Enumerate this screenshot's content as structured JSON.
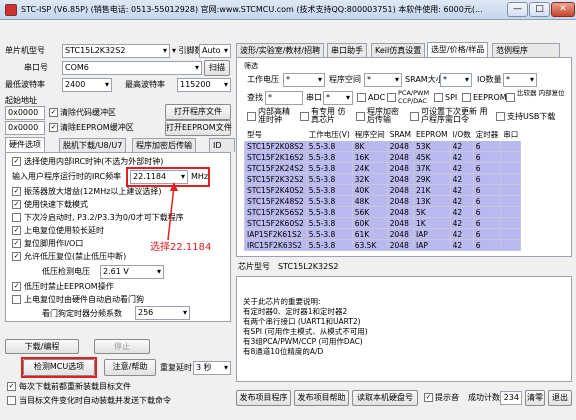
{
  "window": {
    "title": "STC-ISP (V6.85P) (销售电话: 0513-55012928) 官网:www.STCMCU.com (技术支持QQ:800003751) 本软件使用: 6000元(...",
    "min_glyph": "—",
    "max_glyph": "□",
    "close_glyph": "✕"
  },
  "left": {
    "mcu_type_label": "单片机型号",
    "mcu_type_value": "STC15L2K32S2",
    "pin_label": "▾ 引脚数",
    "pin_value": "Auto",
    "port_label": "串口号",
    "port_value": "COM6",
    "scan_button": "扫描",
    "min_baud_label": "最低波特率",
    "min_baud_value": "2400",
    "max_baud_label": "最高波特率",
    "max_baud_value": "115200",
    "start_addr_label": "起始地址",
    "addr1_value": "0x0000",
    "clear_code_label": "清除代码缓冲区",
    "open_program_button": "打开程序文件",
    "addr2_value": "0x0000",
    "clear_eeprom_label": "清除EEPROM缓冲区",
    "open_eeprom_button": "打开EEPROM文件",
    "hw_tabs": [
      "硬件选项",
      "脱机下载/U8/U7",
      "程序加密后传输",
      "ID"
    ],
    "hw_options": [
      {
        "label": "选择使用内部IRC时钟(不选为外部时钟)",
        "checked": true
      },
      {
        "label": "输入用户程序运行时的IRC频率",
        "checked": false
      },
      {
        "label": "振荡器放大增益(12MHz以上建议选择)",
        "checked": true
      },
      {
        "label": "使用快速下载模式",
        "checked": true
      },
      {
        "label": "下次冷启动时, P3.2/P3.3为0/0才可下载程序",
        "checked": false
      },
      {
        "label": "上电复位使用较长延时",
        "checked": true
      },
      {
        "label": "复位脚用作I/O口",
        "checked": true
      },
      {
        "label": "允许低压复位(禁止低压中断)",
        "checked": true
      },
      {
        "label": "低压检测电压",
        "checked": false
      },
      {
        "label": "低压时禁止EEPROM操作",
        "checked": true
      },
      {
        "label": "上电复位时由硬件自动启动看门狗",
        "checked": false
      },
      {
        "label": "看门狗定时器分频系数",
        "checked": false
      }
    ],
    "irc_freq_value": "22.1184",
    "irc_unit": "MHz",
    "voltage_value": "2.61 V",
    "watchdog_value": "256",
    "annotation": "选择22.1184",
    "download_button": "下载/编程",
    "stop_button": "停止",
    "detect_button": "检测MCU选项",
    "help_button": "注意/帮助",
    "retry_label": "重复延时",
    "retry_value": "3 秒",
    "reload_label": "每次下载前都重新装载目标文件",
    "auto_send_label": "当目标文件变化时自动装载并发送下载命令"
  },
  "right": {
    "top_tabs": [
      "波形/实验室/教材/招聘",
      "串口助手",
      "Keil仿真设置",
      "选型/价格/样品",
      "范例程序"
    ],
    "active_tab_index": 3,
    "filter_title": "筛选",
    "workv_label": "工作电压",
    "workv_value": "*",
    "progspace_label": "程序空间",
    "progspace_value": "*",
    "sram_label": "SRAM大小",
    "sram_value": "*",
    "io_label": "IO数量",
    "io_value": "*",
    "find_label": "查找",
    "find_value": "*",
    "uart_label": "串口",
    "uart_value": "*",
    "filter_checks": [
      "ADC",
      "PCA/PWM CCP/DAC",
      "SPI",
      "EEPROM",
      "比较器 内部复位"
    ],
    "filter_checks2": [
      "内部高精 准时钟",
      "有专用 仿真芯片",
      "程序加密 后传输",
      "可设置下次更新 用户程序需口令",
      "支持USB下载"
    ],
    "table_headers": [
      "型号",
      "工作电压(V)",
      "程序空间",
      "SRAM",
      "EEPROM",
      "I/O数",
      "定时器",
      "串口"
    ],
    "table_rows": [
      [
        "STC15F2K08S2",
        "5.5-3.8",
        "8K",
        "2048",
        "53K",
        "42",
        "6",
        ""
      ],
      [
        "STC15F2K16S2",
        "5.5-3.8",
        "16K",
        "2048",
        "45K",
        "42",
        "6",
        ""
      ],
      [
        "STC15F2K24S2",
        "5.5-3.8",
        "24K",
        "2048",
        "37K",
        "42",
        "6",
        ""
      ],
      [
        "STC15F2K32S2",
        "5.5-3.8",
        "32K",
        "2048",
        "29K",
        "42",
        "6",
        ""
      ],
      [
        "STC15F2K40S2",
        "5.5-3.8",
        "40K",
        "2048",
        "21K",
        "42",
        "6",
        ""
      ],
      [
        "STC15F2K48S2",
        "5.5-3.8",
        "48K",
        "2048",
        "13K",
        "42",
        "6",
        ""
      ],
      [
        "STC15F2K56S2",
        "5.5-3.8",
        "56K",
        "2048",
        "5K",
        "42",
        "6",
        ""
      ],
      [
        "STC15F2K60S2",
        "5.5-3.8",
        "60K",
        "2048",
        "1K",
        "42",
        "6",
        ""
      ],
      [
        "IAP15F2K61S2",
        "5.5-3.8",
        "61K",
        "2048",
        "IAP",
        "42",
        "6",
        ""
      ],
      [
        "IRC15F2K63S2",
        "5.5-3.8",
        "63.5K",
        "2048",
        "IAP",
        "42",
        "6",
        ""
      ]
    ],
    "chip_label": "芯片型号",
    "chip_value": "STC15L2K32S2",
    "info_lines": [
      "关于此芯片的重要说明:",
      "有定时器0、定时器1和定时器2",
      "有两个串行接口 (UART1和UART2)",
      "有SPI (可用作主模式、从模式不可用)",
      "有3组PCA/PWM/CCP (可用作DAC)",
      "有8通道10位精度的A/D"
    ],
    "publish_project_button": "发布项目程序",
    "publish_help_button": "发布项目帮助",
    "read_disk_button": "读取本机硬盘号",
    "beep_label": "提示音",
    "success_label": "成功计数",
    "success_value": "234",
    "clear_button": "清零",
    "exit_button": "退出"
  }
}
